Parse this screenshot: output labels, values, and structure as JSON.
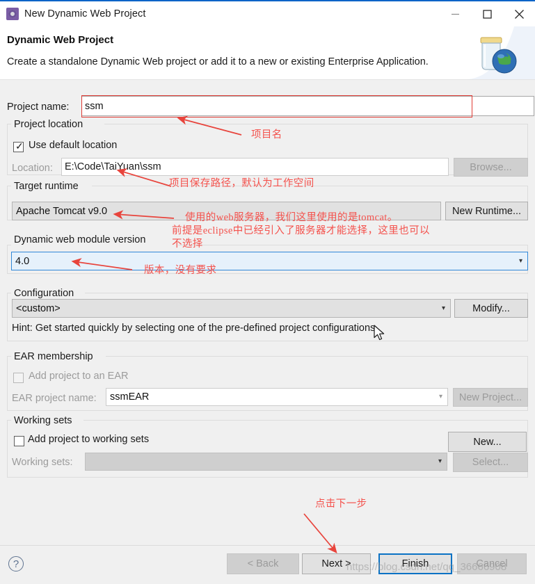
{
  "window": {
    "title": "New Dynamic Web Project",
    "app_icon": "project-wizard-icon",
    "minimize_label": "Minimize",
    "maximize_label": "Maximize",
    "close_label": "Close"
  },
  "banner": {
    "title": "Dynamic Web Project",
    "description": "Create a standalone Dynamic Web project or add it to a new or existing Enterprise Application.",
    "art_icon": "jar-with-globe-icon"
  },
  "form": {
    "project_name_label": "Project name:",
    "project_name_value": "ssm",
    "project_location": {
      "group_title": "Project location",
      "use_default_label": "Use default location",
      "use_default_checked": true,
      "location_label": "Location:",
      "location_value": "E:\\Code\\TaiYuan\\ssm",
      "browse_label": "Browse..."
    },
    "target_runtime": {
      "group_title": "Target runtime",
      "selected": "Apache Tomcat v9.0",
      "new_runtime_label": "New Runtime..."
    },
    "module_version": {
      "group_title": "Dynamic web module version",
      "selected": "4.0"
    },
    "configuration": {
      "group_title": "Configuration",
      "selected": "<custom>",
      "modify_label": "Modify...",
      "hint": "Hint: Get started quickly by selecting one of the pre-defined project configurations."
    },
    "ear_membership": {
      "group_title": "EAR membership",
      "add_to_ear_label": "Add project to an EAR",
      "add_to_ear_checked": false,
      "ear_project_name_label": "EAR project name:",
      "ear_project_name_value": "ssmEAR",
      "new_project_label": "New Project..."
    },
    "working_sets": {
      "group_title": "Working sets",
      "add_to_working_sets_label": "Add project to working sets",
      "add_to_working_sets_checked": false,
      "new_label": "New...",
      "working_sets_label": "Working sets:",
      "working_sets_value": "",
      "select_label": "Select..."
    }
  },
  "footer": {
    "help_label": "?",
    "back_label": "< Back",
    "next_label": "Next >",
    "finish_label": "Finish",
    "cancel_label": "Cancel"
  },
  "annotations": {
    "project_name": "项目名",
    "location": "项目保存路径，默认为工作空间",
    "runtime_line1": "使用的web服务器，我们这里使用的是tomcat。",
    "runtime_line2": "前提是eclipse中已经引入了服务器才能选择，这里也可以",
    "runtime_line3": "不选择",
    "module_version": "版本，没有要求",
    "next_step": "点击下一步"
  },
  "watermark": {
    "text": "https://blog.csdn.net/qq_36666908"
  },
  "colors": {
    "annotation_red": "#f4524d",
    "highlight_box_red": "#e03b34",
    "focus_blue": "#2f87d8",
    "default_button_blue": "#0a72c4",
    "titlebar_accent": "#0a64c8"
  }
}
